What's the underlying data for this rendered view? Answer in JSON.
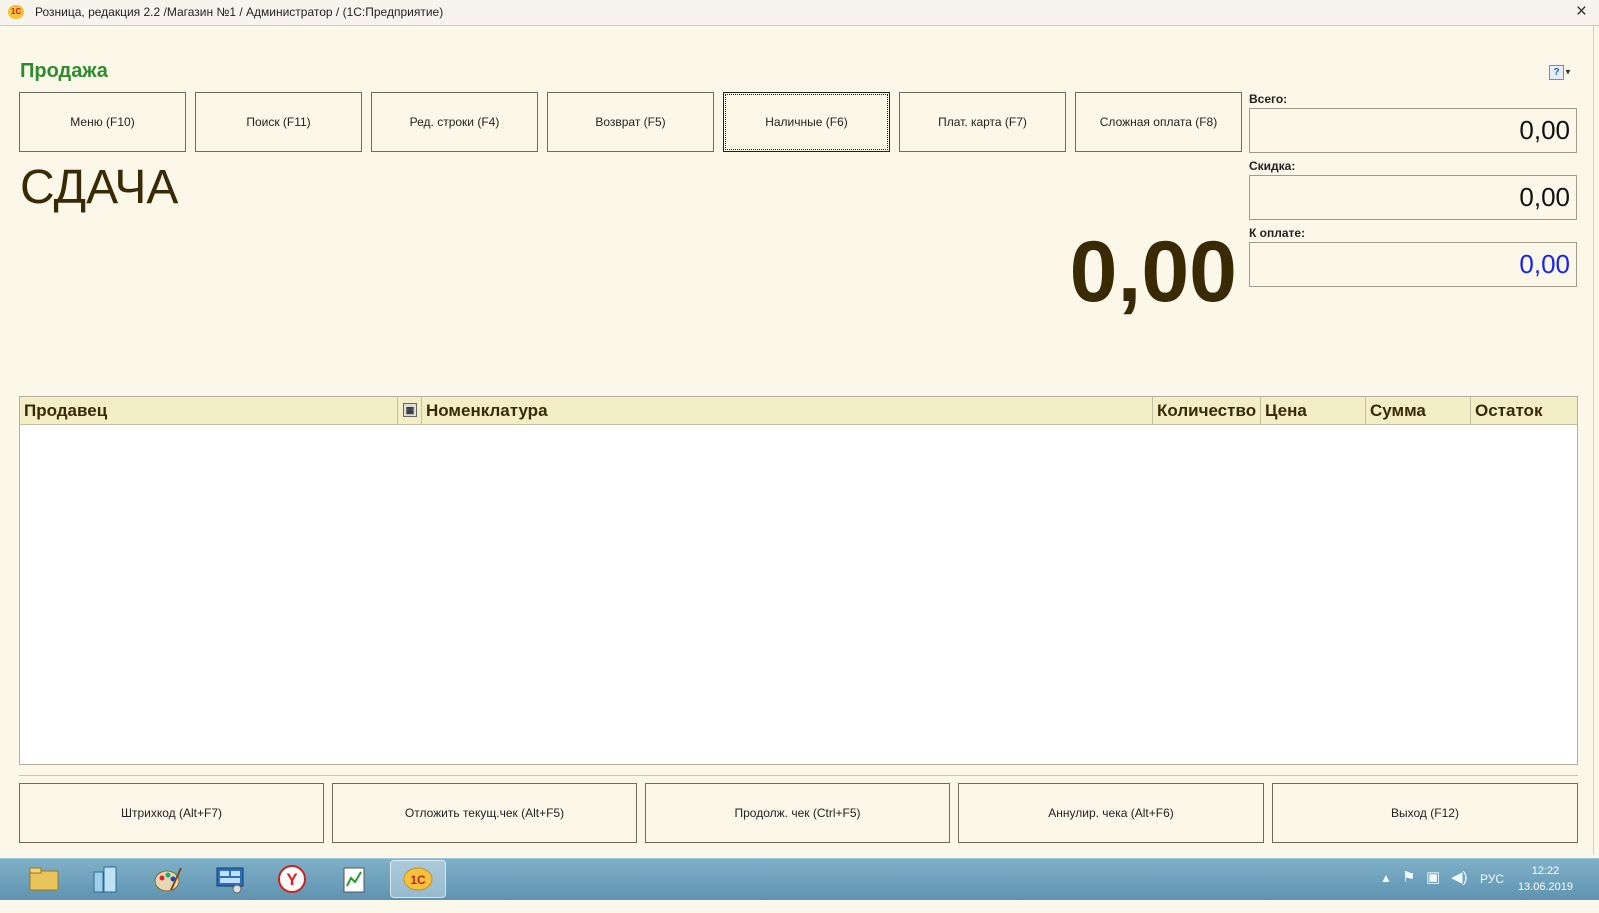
{
  "window": {
    "title": "Розница, редакция 2.2 /Магазин №1 / Администратор /  (1С:Предприятие)",
    "close": "×"
  },
  "form": {
    "title": "Продажа"
  },
  "toolbar": {
    "buttons": [
      {
        "label": "Меню (F10)"
      },
      {
        "label": "Поиск (F11)"
      },
      {
        "label": "Ред. строки (F4)"
      },
      {
        "label": "Возврат (F5)"
      },
      {
        "label": "Наличные (F6)"
      },
      {
        "label": "Плат. карта (F7)"
      },
      {
        "label": "Сложная оплата (F8)"
      }
    ]
  },
  "change": {
    "label": "СДАЧА",
    "value": "0,00"
  },
  "totals": {
    "total_label": "Всего:",
    "total_value": "0,00",
    "discount_label": "Скидка:",
    "discount_value": "0,00",
    "topay_label": "К оплате:",
    "topay_value": "0,00",
    "topay_color": "#1a22ee"
  },
  "table": {
    "columns": [
      "Продавец",
      "Номенклатура",
      "Количество",
      "Цена",
      "Сумма",
      "Остаток"
    ],
    "rows": []
  },
  "bottom": {
    "buttons": [
      {
        "label": "Штрихкод (Alt+F7)"
      },
      {
        "label": "Отложить текущ.чек (Alt+F5)"
      },
      {
        "label": "Продолж. чек (Ctrl+F5)"
      },
      {
        "label": "Аннулир. чека (Alt+F6)"
      },
      {
        "label": "Выход (F12)"
      }
    ]
  },
  "taskbar": {
    "icons": [
      "folder-icon",
      "buildings-icon",
      "paint-icon",
      "control-panel-icon",
      "yandex-browser-icon",
      "chart-notepad-icon",
      "1c-icon"
    ],
    "language": "РУС",
    "time": "12:22",
    "date": "13.06.2019"
  }
}
